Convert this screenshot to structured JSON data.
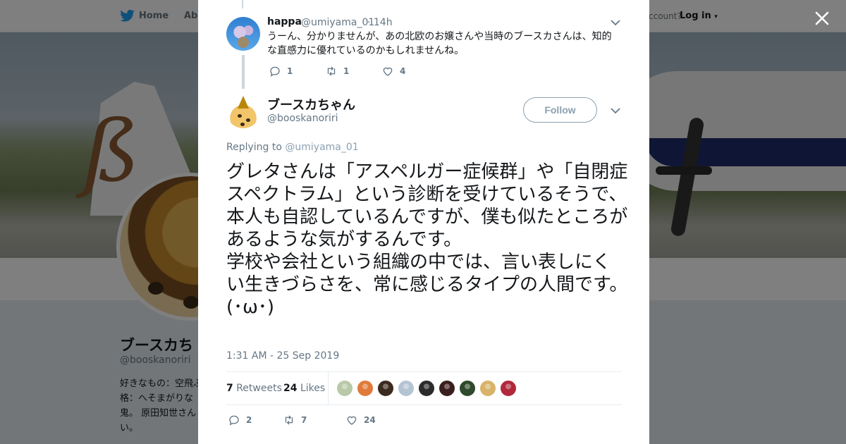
{
  "background": {
    "nav": {
      "home": "Home",
      "about": "Abo",
      "account_text": "ccount?",
      "login": "Log in"
    },
    "profile": {
      "name": "ブースカち",
      "handle": "@booskanoriri",
      "bio": "好きなもの：空飛ぶ 格：へそまがりな 鬼。 原田知世さん い。"
    }
  },
  "reply_tweet": {
    "name": "happa",
    "handle": "@umiyama_01",
    "time": "· 14h",
    "text": "うーん、分かりませんが、あの北欧のお嬢さんや当時のブースカさんは、知的な直感力に優れているのかもしれませんね。",
    "replies": "1",
    "retweets": "1",
    "likes": "4"
  },
  "main_tweet": {
    "name": "ブースカちゃん",
    "handle": "@booskanoriri",
    "follow_label": "Follow",
    "replying_prefix": "Replying to ",
    "replying_to": "@umiyama_01",
    "text": "グレタさんは「アスペルガー症候群」や「自閉症スペクトラム」という診断を受けているそうで、本人も自認しているんですが、僕も似たところがあるような気がするんです。\n学校や会社という組織の中では、言い表しにくい生きづらさを、常に感じるタイプの人間です。\n(･ω･)",
    "timestamp": "1:31 AM - 25 Sep 2019",
    "retweet_count": "7",
    "retweet_label": "Retweets",
    "like_count": "24",
    "like_label": "Likes",
    "replies": "2",
    "retweets": "7",
    "likes": "24"
  },
  "liker_colors": [
    "#b9c9a8",
    "#e07a3a",
    "#3b2a1f",
    "#b5c4d3",
    "#2b2b2b",
    "#3a1e1e",
    "#2f4a2a",
    "#d8b36a",
    "#b0283a"
  ],
  "icons": [
    "twitter-bird-icon",
    "close-icon",
    "chevron-down-icon",
    "reply-icon",
    "retweet-icon",
    "heart-icon"
  ]
}
